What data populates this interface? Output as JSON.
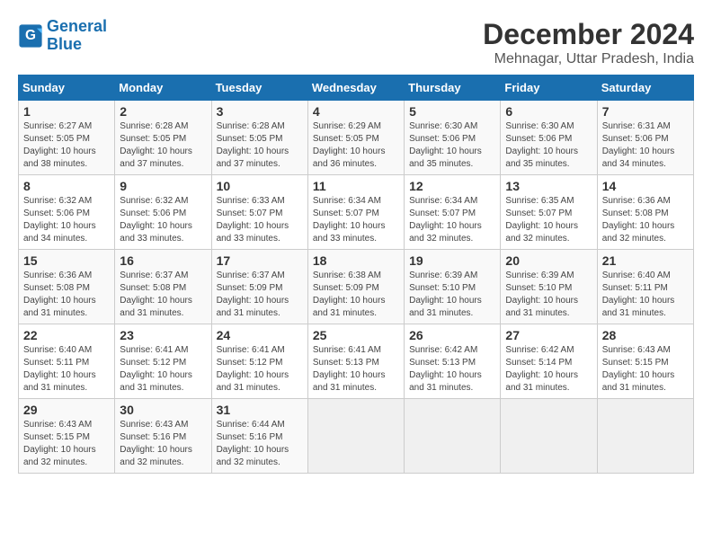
{
  "logo": {
    "line1": "General",
    "line2": "Blue"
  },
  "title": "December 2024",
  "subtitle": "Mehnagar, Uttar Pradesh, India",
  "days_of_week": [
    "Sunday",
    "Monday",
    "Tuesday",
    "Wednesday",
    "Thursday",
    "Friday",
    "Saturday"
  ],
  "weeks": [
    [
      {
        "day": "1",
        "info": "Sunrise: 6:27 AM\nSunset: 5:05 PM\nDaylight: 10 hours\nand 38 minutes."
      },
      {
        "day": "2",
        "info": "Sunrise: 6:28 AM\nSunset: 5:05 PM\nDaylight: 10 hours\nand 37 minutes."
      },
      {
        "day": "3",
        "info": "Sunrise: 6:28 AM\nSunset: 5:05 PM\nDaylight: 10 hours\nand 37 minutes."
      },
      {
        "day": "4",
        "info": "Sunrise: 6:29 AM\nSunset: 5:05 PM\nDaylight: 10 hours\nand 36 minutes."
      },
      {
        "day": "5",
        "info": "Sunrise: 6:30 AM\nSunset: 5:06 PM\nDaylight: 10 hours\nand 35 minutes."
      },
      {
        "day": "6",
        "info": "Sunrise: 6:30 AM\nSunset: 5:06 PM\nDaylight: 10 hours\nand 35 minutes."
      },
      {
        "day": "7",
        "info": "Sunrise: 6:31 AM\nSunset: 5:06 PM\nDaylight: 10 hours\nand 34 minutes."
      }
    ],
    [
      {
        "day": "8",
        "info": "Sunrise: 6:32 AM\nSunset: 5:06 PM\nDaylight: 10 hours\nand 34 minutes."
      },
      {
        "day": "9",
        "info": "Sunrise: 6:32 AM\nSunset: 5:06 PM\nDaylight: 10 hours\nand 33 minutes."
      },
      {
        "day": "10",
        "info": "Sunrise: 6:33 AM\nSunset: 5:07 PM\nDaylight: 10 hours\nand 33 minutes."
      },
      {
        "day": "11",
        "info": "Sunrise: 6:34 AM\nSunset: 5:07 PM\nDaylight: 10 hours\nand 33 minutes."
      },
      {
        "day": "12",
        "info": "Sunrise: 6:34 AM\nSunset: 5:07 PM\nDaylight: 10 hours\nand 32 minutes."
      },
      {
        "day": "13",
        "info": "Sunrise: 6:35 AM\nSunset: 5:07 PM\nDaylight: 10 hours\nand 32 minutes."
      },
      {
        "day": "14",
        "info": "Sunrise: 6:36 AM\nSunset: 5:08 PM\nDaylight: 10 hours\nand 32 minutes."
      }
    ],
    [
      {
        "day": "15",
        "info": "Sunrise: 6:36 AM\nSunset: 5:08 PM\nDaylight: 10 hours\nand 31 minutes."
      },
      {
        "day": "16",
        "info": "Sunrise: 6:37 AM\nSunset: 5:08 PM\nDaylight: 10 hours\nand 31 minutes."
      },
      {
        "day": "17",
        "info": "Sunrise: 6:37 AM\nSunset: 5:09 PM\nDaylight: 10 hours\nand 31 minutes."
      },
      {
        "day": "18",
        "info": "Sunrise: 6:38 AM\nSunset: 5:09 PM\nDaylight: 10 hours\nand 31 minutes."
      },
      {
        "day": "19",
        "info": "Sunrise: 6:39 AM\nSunset: 5:10 PM\nDaylight: 10 hours\nand 31 minutes."
      },
      {
        "day": "20",
        "info": "Sunrise: 6:39 AM\nSunset: 5:10 PM\nDaylight: 10 hours\nand 31 minutes."
      },
      {
        "day": "21",
        "info": "Sunrise: 6:40 AM\nSunset: 5:11 PM\nDaylight: 10 hours\nand 31 minutes."
      }
    ],
    [
      {
        "day": "22",
        "info": "Sunrise: 6:40 AM\nSunset: 5:11 PM\nDaylight: 10 hours\nand 31 minutes."
      },
      {
        "day": "23",
        "info": "Sunrise: 6:41 AM\nSunset: 5:12 PM\nDaylight: 10 hours\nand 31 minutes."
      },
      {
        "day": "24",
        "info": "Sunrise: 6:41 AM\nSunset: 5:12 PM\nDaylight: 10 hours\nand 31 minutes."
      },
      {
        "day": "25",
        "info": "Sunrise: 6:41 AM\nSunset: 5:13 PM\nDaylight: 10 hours\nand 31 minutes."
      },
      {
        "day": "26",
        "info": "Sunrise: 6:42 AM\nSunset: 5:13 PM\nDaylight: 10 hours\nand 31 minutes."
      },
      {
        "day": "27",
        "info": "Sunrise: 6:42 AM\nSunset: 5:14 PM\nDaylight: 10 hours\nand 31 minutes."
      },
      {
        "day": "28",
        "info": "Sunrise: 6:43 AM\nSunset: 5:15 PM\nDaylight: 10 hours\nand 31 minutes."
      }
    ],
    [
      {
        "day": "29",
        "info": "Sunrise: 6:43 AM\nSunset: 5:15 PM\nDaylight: 10 hours\nand 32 minutes."
      },
      {
        "day": "30",
        "info": "Sunrise: 6:43 AM\nSunset: 5:16 PM\nDaylight: 10 hours\nand 32 minutes."
      },
      {
        "day": "31",
        "info": "Sunrise: 6:44 AM\nSunset: 5:16 PM\nDaylight: 10 hours\nand 32 minutes."
      },
      {
        "day": "",
        "info": ""
      },
      {
        "day": "",
        "info": ""
      },
      {
        "day": "",
        "info": ""
      },
      {
        "day": "",
        "info": ""
      }
    ]
  ]
}
